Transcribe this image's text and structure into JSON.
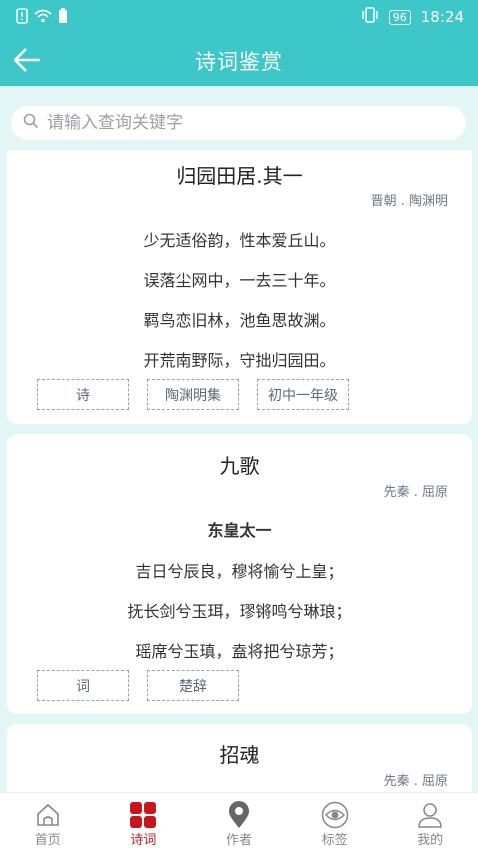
{
  "status": {
    "time": "18:24",
    "battery": "96"
  },
  "appbar": {
    "title": "诗词鉴赏"
  },
  "search": {
    "placeholder": "请输入查询关键字"
  },
  "poems": [
    {
      "title": "归园田居.其一",
      "author": "晋朝 . 陶渊明",
      "lines": [
        "少无适俗韵，性本爱丘山。",
        "误落尘网中，一去三十年。",
        "羁鸟恋旧林，池鱼思故渊。",
        "开荒南野际，守拙归园田。"
      ],
      "tags": [
        "诗",
        "陶渊明集",
        "初中一年级"
      ]
    },
    {
      "title": "九歌",
      "author": "先秦 . 屈原",
      "subtitle": "东皇太一",
      "lines": [
        "吉日兮辰良，穆将愉兮上皇；",
        "抚长剑兮玉珥，璆锵鸣兮琳琅；",
        "瑶席兮玉瑱，盍将把兮琼芳；"
      ],
      "tags": [
        "词",
        "楚辞"
      ]
    },
    {
      "title": "招魂",
      "author": "先秦 . 屈原"
    }
  ],
  "tabs": [
    {
      "label": "首页",
      "icon": "home-icon"
    },
    {
      "label": "诗词",
      "icon": "grid-icon",
      "active": true
    },
    {
      "label": "作者",
      "icon": "location-pin-icon"
    },
    {
      "label": "标签",
      "icon": "eye-icon"
    },
    {
      "label": "我的",
      "icon": "person-icon"
    }
  ],
  "colors": {
    "primary": "#3ec7c9",
    "active_tab": "#c8161e",
    "background": "#e3f6f6"
  }
}
